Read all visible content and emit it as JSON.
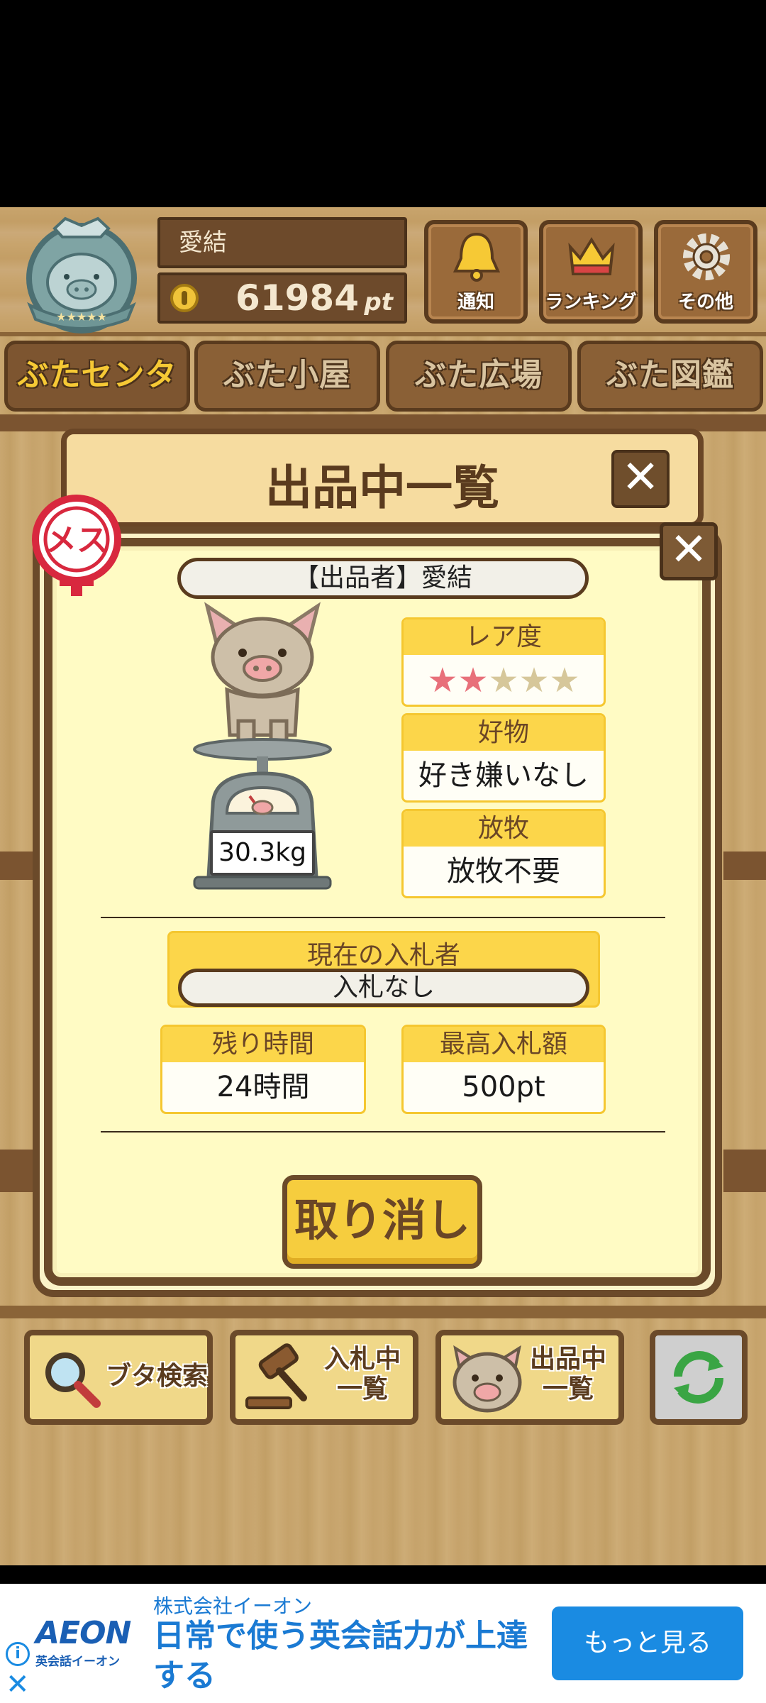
{
  "header": {
    "player_name": "愛結",
    "points": "61984",
    "points_unit": "pt",
    "buttons": {
      "notice": "通知",
      "ranking": "ランキング",
      "other": "その他"
    }
  },
  "tabs": [
    {
      "label": "ぶたセンター",
      "active": true
    },
    {
      "label": "ぶた小屋",
      "active": false
    },
    {
      "label": "ぶた広場",
      "active": false
    },
    {
      "label": "ぶた図鑑",
      "active": false
    }
  ],
  "list_dialog": {
    "title": "出品中一覧",
    "close": "✕"
  },
  "detail": {
    "gender": "メス",
    "close": "✕",
    "seller": "【出品者】愛結",
    "weight": "30.3kg",
    "rarity": {
      "label": "レア度",
      "stars_filled": 2,
      "stars_total": 5
    },
    "likes": {
      "label": "好物",
      "value": "好き嫌いなし"
    },
    "grazing": {
      "label": "放牧",
      "value": "放牧不要"
    },
    "current_bidder": {
      "label": "現在の入札者",
      "value": "入札なし"
    },
    "time_left": {
      "label": "残り時間",
      "value": "24時間"
    },
    "max_bid": {
      "label": "最高入札額",
      "value": "500pt"
    },
    "cancel": "取り消し"
  },
  "bottom_buttons": {
    "search": "ブタ検索",
    "bidding_line1": "入札中",
    "bidding_line2": "一覧",
    "listing_line1": "出品中",
    "listing_line2": "一覧"
  },
  "colors": {
    "accent_yellow": "#fcd64a",
    "dark_wood": "#6b4a2a",
    "cream": "#fffbc4",
    "star_filled": "#e8707a",
    "star_empty": "#d6c79a"
  },
  "ad": {
    "logo": "AEON",
    "logo_sub": "英会話イーオン",
    "company": "株式会社イーオン",
    "headline": "日常で使う英会話力が上達する",
    "cta": "もっと見る",
    "info_icon": "i",
    "close_icon": "✕"
  }
}
